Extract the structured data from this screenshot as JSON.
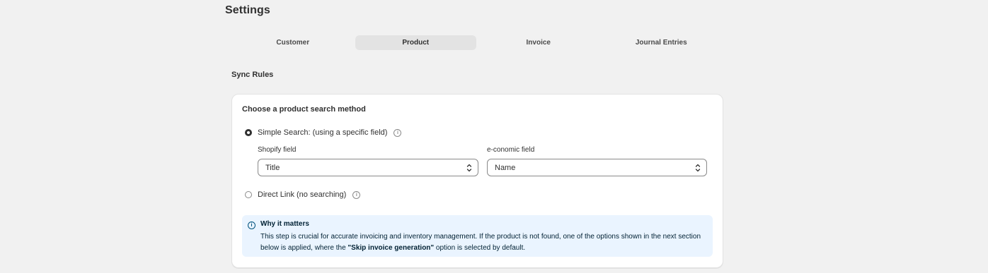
{
  "page": {
    "title": "Settings"
  },
  "tabs": [
    {
      "label": "Customer",
      "active": false
    },
    {
      "label": "Product",
      "active": true
    },
    {
      "label": "Invoice",
      "active": false
    },
    {
      "label": "Journal Entries",
      "active": false
    }
  ],
  "section": {
    "title": "Sync Rules"
  },
  "card": {
    "title": "Choose a product search method",
    "options": [
      {
        "label": "Simple Search: (using a specific field)",
        "checked": true,
        "icon": "info-icon"
      },
      {
        "label": "Direct Link (no searching)",
        "checked": false,
        "icon": "info-icon"
      }
    ],
    "shopify_field": {
      "label": "Shopify field",
      "value": "Title"
    },
    "economic_field": {
      "label": "e-conomic field",
      "value": "Name"
    }
  },
  "banner": {
    "icon": "info-icon",
    "title": "Why it matters",
    "text_before": "This step is crucial for accurate invoicing and inventory management. If the product is not found, one of the options shown in the next section below is applied, where the ",
    "highlight": "\"Skip invoice generation\"",
    "text_after": " option is selected by default.",
    "background_color": "#eaf4ff"
  }
}
